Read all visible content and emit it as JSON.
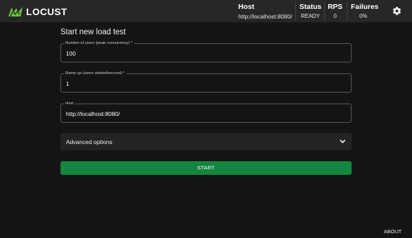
{
  "app": {
    "name": "LOCUST"
  },
  "header": {
    "host": {
      "label": "Host",
      "value": "http://localhost:8080/"
    },
    "status": {
      "label": "Status",
      "value": "READY"
    },
    "rps": {
      "label": "RPS",
      "value": "0"
    },
    "failures": {
      "label": "Failures",
      "value": "0%"
    },
    "settings_icon": "gear-icon"
  },
  "form": {
    "title": "Start new load test",
    "users": {
      "label": "Number of users (peak concurrency) *",
      "value": "100"
    },
    "ramp_up": {
      "label": "Ramp up (users started/second) *",
      "value": "1"
    },
    "host": {
      "label": "Host",
      "value": "http://localhost:8080/"
    },
    "advanced_options_label": "Advanced options",
    "start_label": "START"
  },
  "footer": {
    "about_label": "ABOUT"
  },
  "colors": {
    "background": "#141414",
    "topbar": "#272727",
    "accent_green": "#148640",
    "logo_green": "#69c23a"
  }
}
